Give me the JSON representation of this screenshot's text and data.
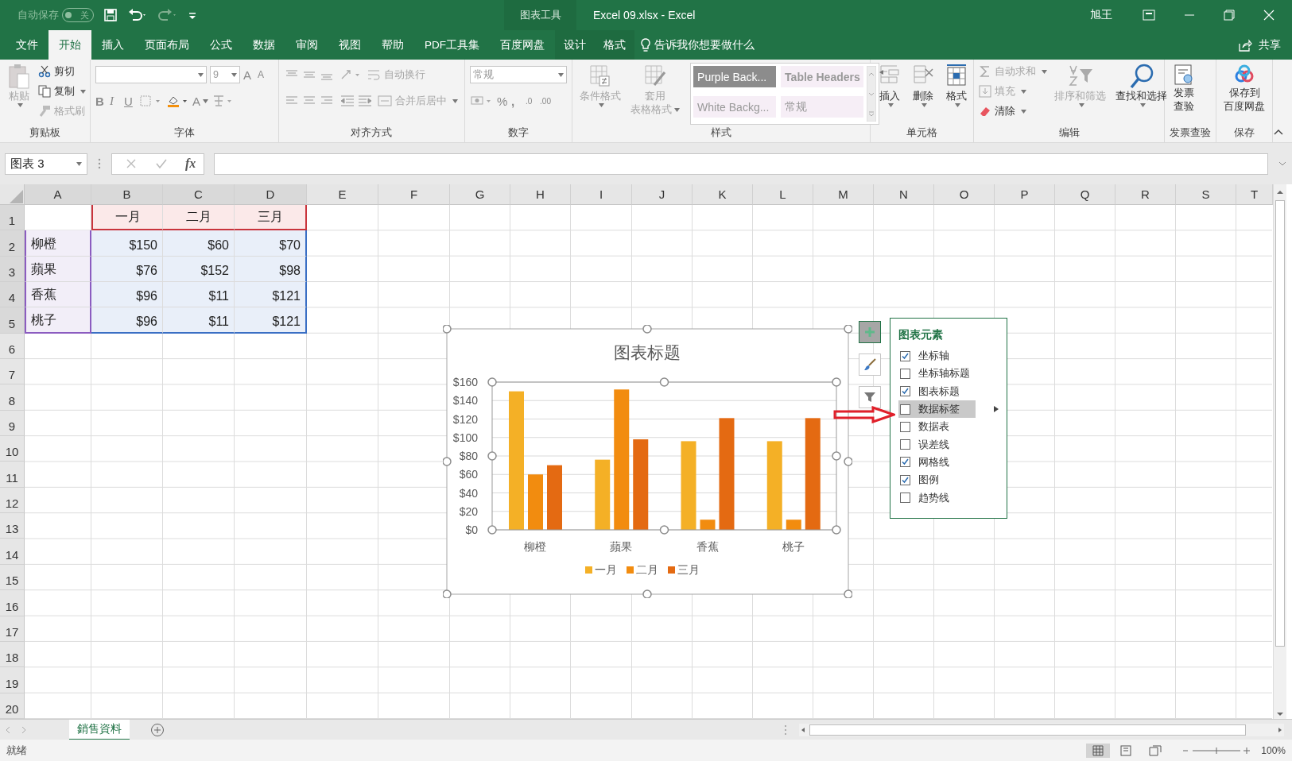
{
  "title_bar": {
    "autosave_label": "自动保存",
    "autosave": {
      "label": "关",
      "on": false
    },
    "chart_tools": "图表工具",
    "title": "Excel 09.xlsx  -  Excel",
    "user": "旭王"
  },
  "menu_tabs": [
    {
      "label": "文件",
      "selected": false,
      "kind": "normal"
    },
    {
      "label": "开始",
      "selected": true,
      "kind": "normal"
    },
    {
      "label": "插入",
      "selected": false,
      "kind": "normal"
    },
    {
      "label": "页面布局",
      "selected": false,
      "kind": "normal"
    },
    {
      "label": "公式",
      "selected": false,
      "kind": "normal"
    },
    {
      "label": "数据",
      "selected": false,
      "kind": "normal"
    },
    {
      "label": "审阅",
      "selected": false,
      "kind": "normal"
    },
    {
      "label": "视图",
      "selected": false,
      "kind": "normal"
    },
    {
      "label": "帮助",
      "selected": false,
      "kind": "normal"
    },
    {
      "label": "PDF工具集",
      "selected": false,
      "kind": "normal"
    },
    {
      "label": "百度网盘",
      "selected": false,
      "kind": "normal"
    },
    {
      "label": "设计",
      "selected": false,
      "kind": "context"
    },
    {
      "label": "格式",
      "selected": false,
      "kind": "context"
    }
  ],
  "tell_me": "告诉我你想要做什么",
  "share": "共享",
  "ribbon": [
    {
      "kind": "clipboard",
      "label": "剪贴板",
      "paste": {
        "label": "粘贴",
        "disabled": true
      },
      "cut": {
        "label": "剪切",
        "disabled": false
      },
      "copy": {
        "label": "复制",
        "disabled": false
      },
      "painter": {
        "label": "格式刷",
        "disabled": true
      }
    },
    {
      "kind": "font",
      "label": "字体",
      "size": "9",
      "bold": "B",
      "italic": "I",
      "underline": "U",
      "grow": "A",
      "shrink": "A",
      "font_color": "A"
    },
    {
      "kind": "alignment",
      "label": "对齐方式",
      "wrap": {
        "label": "自动换行",
        "disabled": true
      },
      "merge": {
        "label": "合并后居中",
        "disabled": true
      }
    },
    {
      "kind": "number",
      "label": "数字",
      "format": "常规",
      "percent": "%",
      "comma": ",",
      "decimals": [
        ".0",
        ".00"
      ]
    },
    {
      "kind": "styles",
      "label": "样式",
      "conditional": {
        "label": "条件格式",
        "disabled": true
      },
      "table": {
        "lines": [
          "套用",
          "表格格式"
        ],
        "disabled": true
      },
      "cell_styles": [
        {
          "label": "Purple Back...",
          "selected": true
        },
        {
          "label": "Table Headers",
          "selected": false
        },
        {
          "label": "White Backg...",
          "selected": false
        },
        {
          "label": "常规",
          "selected": false
        }
      ]
    },
    {
      "kind": "cells",
      "label": "单元格",
      "buttons": [
        {
          "label": "插入"
        },
        {
          "label": "删除"
        },
        {
          "label": "格式"
        }
      ]
    },
    {
      "kind": "editing",
      "label": "编辑",
      "autosum": {
        "label": "自动求和",
        "disabled": true
      },
      "fill": {
        "label": "填充",
        "disabled": true
      },
      "clear": {
        "label": "清除",
        "disabled": false
      },
      "sort": {
        "label": "排序和筛选",
        "disabled": true
      },
      "find": {
        "label": "查找和选择",
        "disabled": false
      }
    },
    {
      "kind": "large",
      "label": "发票查验",
      "buttons": [
        {
          "lines": [
            "发票",
            "查验"
          ]
        }
      ]
    },
    {
      "kind": "large",
      "label": "保存",
      "buttons": [
        {
          "lines": [
            "保存到",
            "百度网盘"
          ]
        }
      ]
    }
  ],
  "formula_bar": {
    "name_box": "图表 3",
    "fx": "fx"
  },
  "sheet": {
    "columns": [
      "A",
      "B",
      "C",
      "D",
      "E",
      "F",
      "G",
      "H",
      "I",
      "J",
      "K",
      "L",
      "M",
      "N",
      "O",
      "P",
      "Q",
      "R",
      "S",
      "T"
    ],
    "row_numbers": [
      "1",
      "2",
      "3",
      "4",
      "5",
      "6",
      "7",
      "8",
      "9",
      "10",
      "11",
      "12",
      "13",
      "14",
      "15",
      "16",
      "17",
      "18",
      "19",
      "20"
    ],
    "header_row": [
      "一月",
      "二月",
      "三月"
    ],
    "data_rows": [
      {
        "label": "柳橙",
        "values": [
          "$150",
          "$60",
          "$70"
        ]
      },
      {
        "label": "蘋果",
        "values": [
          "$76",
          "$152",
          "$98"
        ]
      },
      {
        "label": "香蕉",
        "values": [
          "$96",
          "$11",
          "$121"
        ]
      },
      {
        "label": "桃子",
        "values": [
          "$96",
          "$11",
          "$121"
        ]
      }
    ]
  },
  "chart": {
    "chart_data": {
      "type": "bar",
      "title": "图表标题",
      "categories": [
        "柳橙",
        "蘋果",
        "香蕉",
        "桃子"
      ],
      "series": [
        {
          "name": "一月",
          "color": "#f4b026",
          "values": [
            150,
            76,
            96,
            96
          ]
        },
        {
          "name": "二月",
          "color": "#f28c0f",
          "values": [
            60,
            152,
            11,
            11
          ]
        },
        {
          "name": "三月",
          "color": "#e46a12",
          "values": [
            70,
            98,
            121,
            121
          ]
        }
      ],
      "ylim": [
        0,
        160
      ],
      "grid": true,
      "legend": "bottom",
      "yticks": [
        {
          "value": 0,
          "label": "$0"
        },
        {
          "value": 20,
          "label": "$20"
        },
        {
          "value": 40,
          "label": "$40"
        },
        {
          "value": 60,
          "label": "$60"
        },
        {
          "value": 80,
          "label": "$80"
        },
        {
          "value": 100,
          "label": "$100"
        },
        {
          "value": 120,
          "label": "$120"
        },
        {
          "value": 140,
          "label": "$140"
        },
        {
          "value": 160,
          "label": "$160"
        }
      ]
    }
  },
  "chart_elements": {
    "title": "图表元素",
    "items": [
      {
        "label": "坐标轴",
        "checked": true,
        "selected": false
      },
      {
        "label": "坐标轴标题",
        "checked": false,
        "selected": false
      },
      {
        "label": "图表标题",
        "checked": true,
        "selected": false
      },
      {
        "label": "数据标签",
        "checked": false,
        "selected": true
      },
      {
        "label": "数据表",
        "checked": false,
        "selected": false
      },
      {
        "label": "误差线",
        "checked": false,
        "selected": false
      },
      {
        "label": "网格线",
        "checked": true,
        "selected": false
      },
      {
        "label": "图例",
        "checked": true,
        "selected": false
      },
      {
        "label": "趋势线",
        "checked": false,
        "selected": false
      }
    ]
  },
  "sheet_tabs": [
    {
      "label": "銷售資料",
      "selected": true
    }
  ],
  "status_bar": {
    "status": "就绪",
    "zoom": "100%"
  }
}
